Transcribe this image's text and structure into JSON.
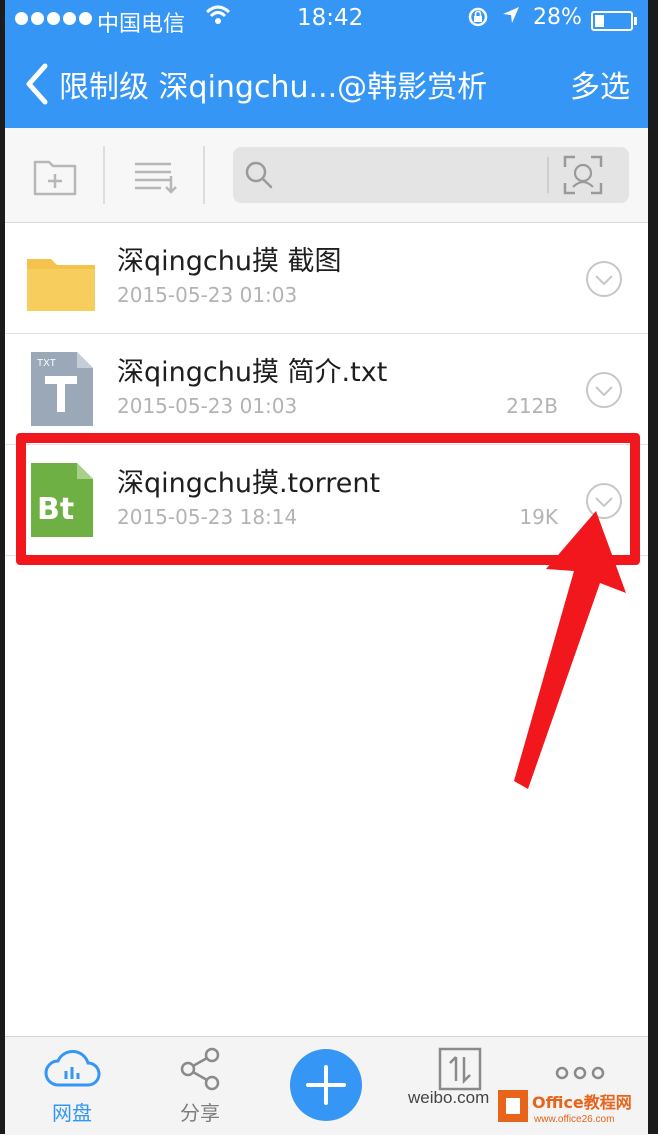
{
  "status_bar": {
    "carrier": "中国电信",
    "time": "18:42",
    "battery": "28%"
  },
  "nav": {
    "title": "限制级 深qingchu...@韩影赏析",
    "multi_select": "多选"
  },
  "search": {
    "placeholder": ""
  },
  "files": [
    {
      "name": "深qingchu摸 截图",
      "date": "2015-05-23 01:03",
      "size": "",
      "type": "folder"
    },
    {
      "name": "深qingchu摸 简介.txt",
      "date": "2015-05-23 01:03",
      "size": "212B",
      "type": "txt",
      "thumb_label": "TXT"
    },
    {
      "name": "深qingchu摸.torrent",
      "date": "2015-05-23 18:14",
      "size": "19K",
      "type": "torrent",
      "thumb_label": "Bt"
    }
  ],
  "tabs": {
    "netdisk": "网盘",
    "share": "分享"
  },
  "watermark": {
    "text": "weibo.com",
    "logo_text": "Office教程网",
    "logo_sub": "www.office26.com"
  },
  "colors": {
    "accent": "#3596f5",
    "annotation": "#f2171c",
    "folder": "#f5c24c",
    "torrent": "#6fb044",
    "txt": "#9aa8b8"
  },
  "icons": [
    "back-chevron-icon",
    "new-folder-icon",
    "sort-icon",
    "search-icon",
    "scan-icon",
    "chevron-down-circle-icon",
    "cloud-icon",
    "share-icon",
    "plus-icon",
    "transfer-icon",
    "more-icon"
  ]
}
